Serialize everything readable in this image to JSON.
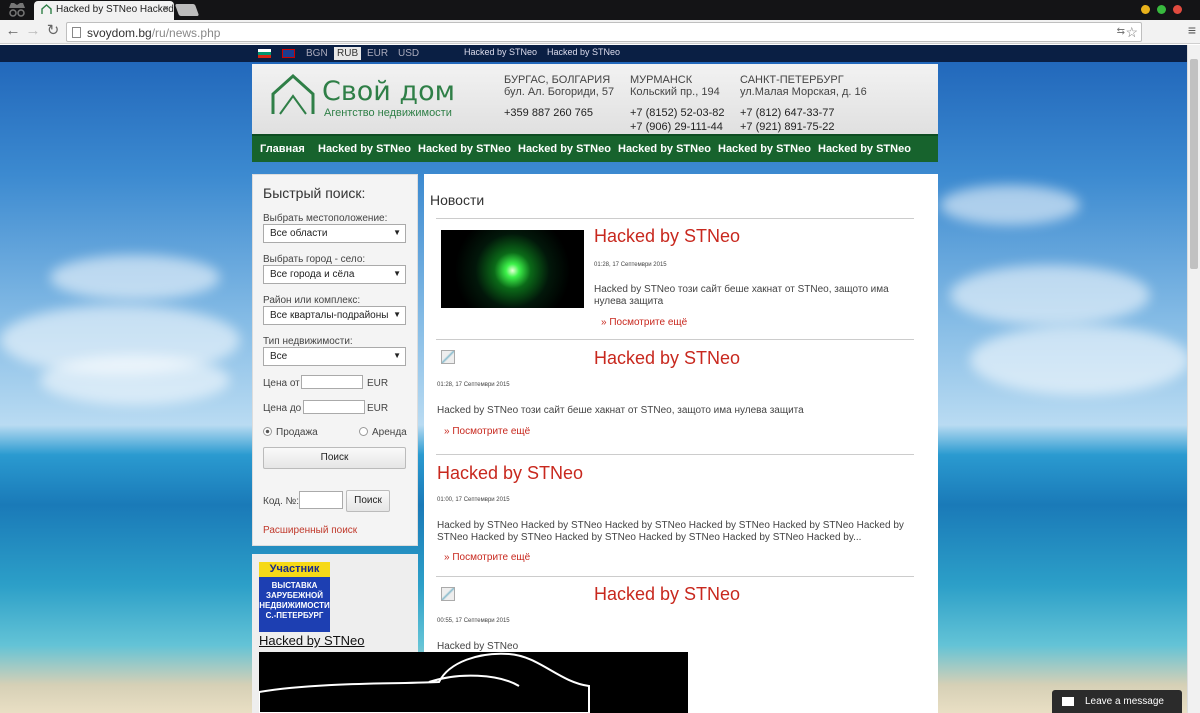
{
  "browser": {
    "tab_title": "Hacked by STNeo Hacked by STNeo",
    "url_domain": "svoydom.bg",
    "url_path": "/ru/news.php"
  },
  "top_strip": {
    "currencies": [
      "BGN",
      "RUB",
      "EUR",
      "USD"
    ],
    "active_currency": "RUB",
    "links": [
      "Hacked by STNeo",
      "Hacked by STNeo"
    ]
  },
  "header": {
    "logo_name": "Свой дом",
    "logo_sub": "Агентство недвижимости",
    "offices": [
      {
        "city": "БУРГАС, БОЛГАРИЯ",
        "address": "бул. Ал. Богориди, 57",
        "phones": [
          "+359 887 260 765"
        ]
      },
      {
        "city": "МУРМАНСК",
        "address": "Кольский пр., 194",
        "phones": [
          "+7 (8152) 52-03-82",
          "+7 (906) 29-111-44"
        ]
      },
      {
        "city": "САНКТ-ПЕТЕРБУРГ",
        "address": "ул.Малая Морская, д. 16",
        "phones": [
          "+7 (812) 647-33-77",
          "+7 (921) 891-75-22"
        ]
      }
    ]
  },
  "menu": [
    "Главная",
    "Hacked by STNeo",
    "Hacked by STNeo",
    "Hacked by STNeo",
    "Hacked by STNeo",
    "Hacked by STNeo",
    "Hacked by STNeo"
  ],
  "search": {
    "title": "Быстрый поиск:",
    "location_label": "Выбрать местоположение:",
    "location_value": "Все области",
    "city_label": "Выбрать город - село:",
    "city_value": "Все города и сёла",
    "district_label": "Район или комплекс:",
    "district_value": "Все кварталы-подрайоны",
    "type_label": "Тип недвижимости:",
    "type_value": "Все",
    "price_from_label": "Цена от",
    "price_to_label": "Цена до",
    "currency": "EUR",
    "sale_label": "Продажа",
    "rent_label": "Аренда",
    "search_button": "Поиск",
    "code_label": "Код. №:",
    "code_button": "Поиск",
    "advanced_link": "Расширенный поиск"
  },
  "side_banner": {
    "badge_top": "Участник",
    "badge_lines": [
      "ВЫСТАВКА",
      "ЗАРУБЕЖНОЙ",
      "НЕДВИЖИМОСТИ",
      "С.-ПЕТЕРБУРГ"
    ],
    "link": "Hacked by STNeo"
  },
  "content": {
    "title": "Новости",
    "news": [
      {
        "title": "Hacked by STNeo",
        "date": "01:28, 17 Септември 2015",
        "text": "Hacked by STNeo  този сайт беше хакнат от STNeo, защото има нулева защита",
        "more": "» Посмотрите ещё"
      },
      {
        "title": "Hacked by STNeo",
        "date": "01:28, 17 Септември 2015",
        "text": "Hacked by STNeo  този сайт беше хакнат от STNeo, защото има нулева защита",
        "more": "» Посмотрите ещё"
      },
      {
        "title": "Hacked by STNeo",
        "date": "01:00, 17 Септември 2015",
        "text": "Hacked by STNeo Hacked by STNeo Hacked by STNeo Hacked by STNeo Hacked by STNeo Hacked by STNeo Hacked by STNeo Hacked by STNeo Hacked by STNeo Hacked by STNeo Hacked by...",
        "more": "» Посмотрите ещё"
      },
      {
        "title": "Hacked by STNeo",
        "date": "00:55, 17 Септември 2015",
        "text": "Hacked by STNeo",
        "more": ""
      }
    ]
  },
  "chat": {
    "label": "Leave a message"
  },
  "colors": {
    "brand_green": "#17632d",
    "news_red": "#c8281e",
    "chrome_dark": "#141416"
  }
}
